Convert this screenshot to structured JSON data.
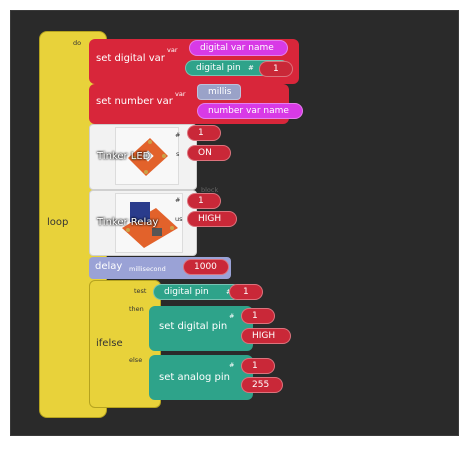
{
  "loop": {
    "label": "loop",
    "do_label": "do"
  },
  "set_digital_var": {
    "label": "set digital var",
    "var_label": "var",
    "name_value": "digital var name",
    "pin_block_label": "digital pin",
    "hash": "#",
    "pin_value": "1"
  },
  "set_number_var": {
    "label": "set number var",
    "var_label": "var",
    "millis_value": "millis",
    "name_value": "number var name"
  },
  "tinker_led": {
    "label": "Tinker LED",
    "hash": "#",
    "status_cut": "s",
    "pin_value": "1",
    "state_value": "ON"
  },
  "tinker_relay": {
    "label": "Tinker Relay",
    "hash": "#",
    "status_cut": "us",
    "pin_value": "1",
    "state_value": "HIGH",
    "cut_text": "block"
  },
  "delay": {
    "label": "delay",
    "unit_label": "millisecond",
    "value": "1000"
  },
  "ifelse": {
    "label": "ifelse",
    "test_label": "test",
    "then_label": "then",
    "else_label": "else",
    "test_block": {
      "label": "digital pin",
      "hash": "#",
      "value": "1"
    },
    "then_block": {
      "label": "set digital pin",
      "hash": "#",
      "pin_value": "1",
      "state_value": "HIGH"
    },
    "else_block": {
      "label": "set analog pin",
      "hash": "#",
      "pin_value": "1",
      "value": "255"
    }
  }
}
